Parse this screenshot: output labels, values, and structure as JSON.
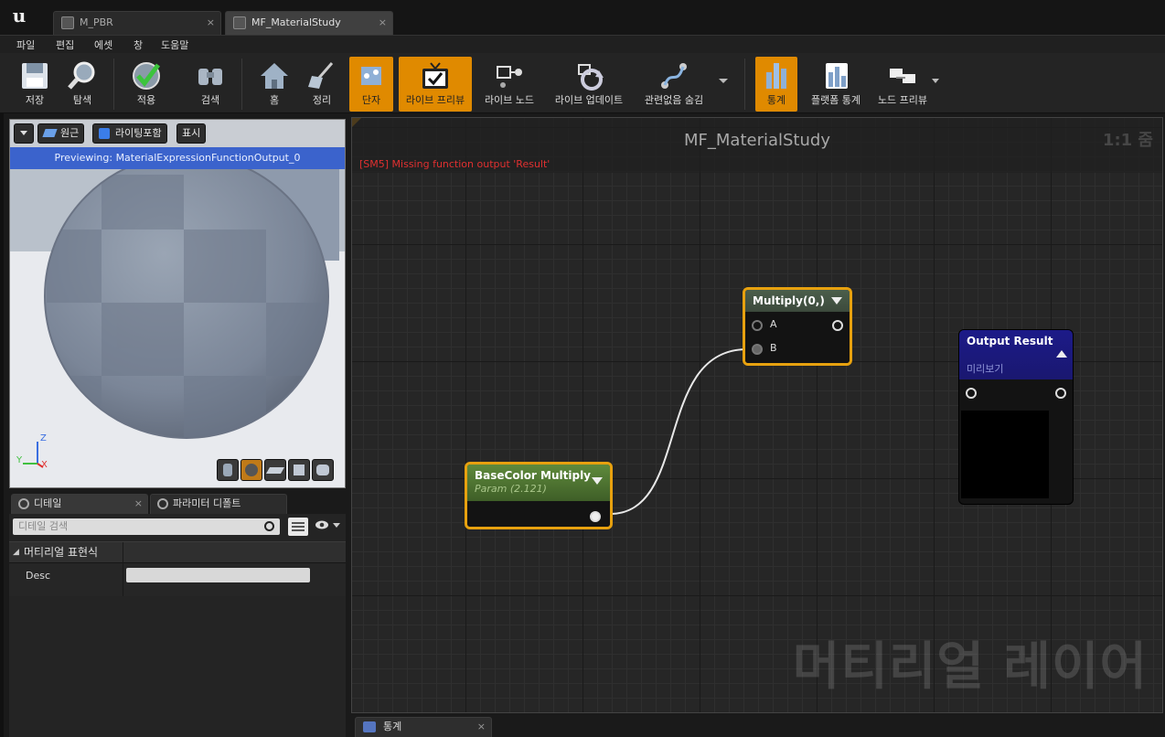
{
  "tabs": [
    {
      "label": "M_PBR",
      "close": "×"
    },
    {
      "label": "MF_MaterialStudy",
      "close": "×"
    }
  ],
  "menu": [
    "파일",
    "편집",
    "에셋",
    "창",
    "도움말"
  ],
  "toolbar": {
    "save": "저장",
    "browse": "탐색",
    "apply": "적용",
    "search": "검색",
    "home": "홈",
    "clean_up": "정리",
    "connectors": "단자",
    "live_preview": "라이브 프리뷰",
    "live_nodes": "라이브 노드",
    "live_update": "라이브 업데이트",
    "hide_unrelated": "관련없음 숨김",
    "stats": "통계",
    "platform_stats": "플랫폼 통계",
    "node_preview": "노드 프리뷰",
    "accent": "#e08a00"
  },
  "viewport": {
    "perspective": "원근",
    "lit": "라이팅포함",
    "show": "표시",
    "previewing": "Previewing: MaterialExpressionFunctionOutput_0",
    "axis_z": "Z",
    "axis_y": "Y",
    "axis_x": "X"
  },
  "panels": {
    "details_tab": "디테일",
    "param_defaults_tab": "파라미터 디폴트",
    "close": "×",
    "search_placeholder": "디테일 검색",
    "category": "머티리얼 표현식",
    "desc_label": "Desc",
    "desc_value": ""
  },
  "graph": {
    "title": "MF_MaterialStudy",
    "zoom": "1:1 줌",
    "error": "[SM5] Missing function output 'Result'",
    "watermark": "머티리얼 레이어",
    "nodes": {
      "multiply": {
        "title": "Multiply(0,)",
        "pin_a": "A",
        "pin_b": "B"
      },
      "basecolor": {
        "title": "BaseColor Multiply",
        "subtitle": "Param (2.121)"
      },
      "output": {
        "title": "Output Result",
        "subtitle": "미리보기"
      }
    },
    "selection_color": "#e7a10f"
  },
  "bottom": {
    "stats_tab": "통계",
    "close": "×"
  }
}
